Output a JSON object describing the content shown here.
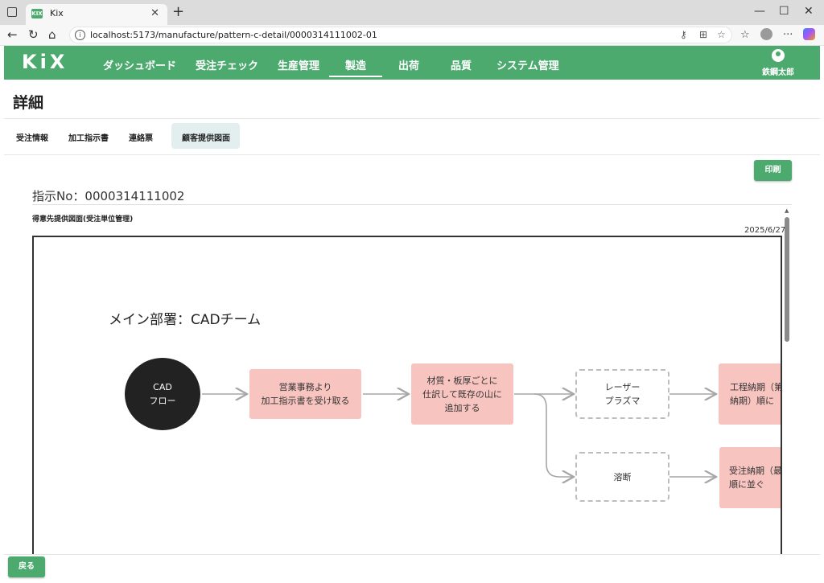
{
  "browser": {
    "tab_title": "Kix",
    "favicon_text": "KIX",
    "url": "localhost:5173/manufacture/pattern-c-detail/0000314111002-01"
  },
  "app": {
    "logo": "KiX",
    "nav": [
      "ダッシュボード",
      "受注チェック",
      "生産管理",
      "製造",
      "出荷",
      "品質",
      "システム管理"
    ],
    "active_nav": "製造",
    "user_name": "鉄鋼太郎",
    "brand_color": "#4caa6e"
  },
  "page": {
    "title": "詳細",
    "subtabs": [
      "受注情報",
      "加工指示書",
      "連絡票",
      "顧客提供図面"
    ],
    "active_subtab": "顧客提供図面",
    "print_label": "印刷",
    "order_no": "指示No：0000314111002",
    "section_label": "得意先提供図面(受注単位管理)",
    "date": "2025/6/27",
    "back_label": "戻る"
  },
  "drawing": {
    "dept_title": "メイン部署：CADチーム",
    "nodes": {
      "start": "CAD\nフロー",
      "receive": "営業事務より\n加工指示書を受け取る",
      "sort": "材質・板厚ごとに\n仕訳して既存の山に\n追加する",
      "laser": "レーザー\nプラズマ",
      "fusing": "溶断",
      "process_due": "工程納期（第\n納期）順に",
      "order_due": "受注納期（最\n順に並ぐ"
    }
  }
}
